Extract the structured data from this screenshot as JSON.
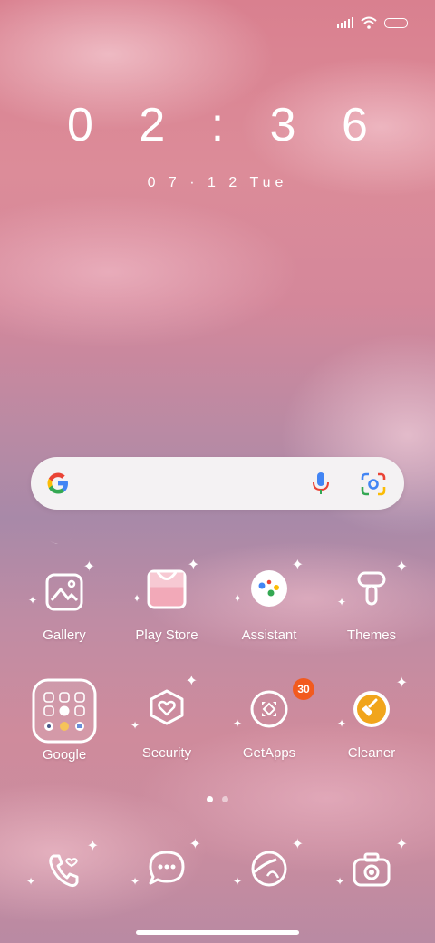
{
  "status_bar": {
    "icons": [
      "signal-icon",
      "wifi-icon",
      "battery-icon"
    ]
  },
  "clock": {
    "time": "0 2 : 3 6"
  },
  "date": {
    "text": "0 7 · 1 2   Tue"
  },
  "search_bar": {
    "icons": [
      "google-icon",
      "mic-icon",
      "lens-icon"
    ]
  },
  "apps": {
    "gallery": "Gallery",
    "play_store": "Play Store",
    "assistant": "Assistant",
    "themes": "Themes",
    "google": "Google",
    "security": "Security",
    "getapps": "GetApps",
    "getapps_badge": "30",
    "cleaner": "Cleaner"
  },
  "dock": {
    "icons": [
      "phone-icon",
      "messages-icon",
      "browser-icon",
      "camera-icon"
    ]
  },
  "page_indicator": {
    "pages": 2,
    "active": 1
  },
  "colors": {
    "accent_badge": "#f25a1f",
    "cleaner_yellow": "#f1a51c"
  }
}
